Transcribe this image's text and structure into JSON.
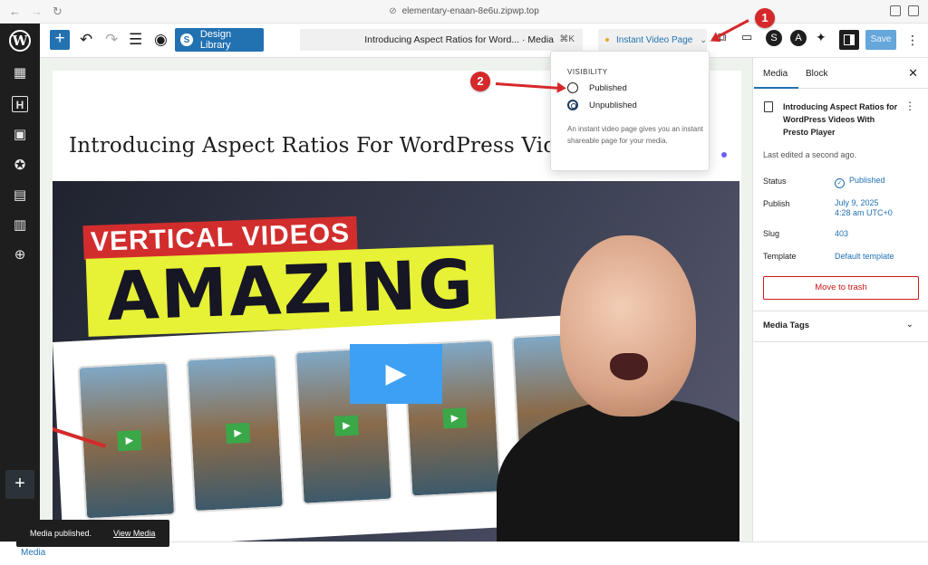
{
  "browser": {
    "url": "elementary-enaan-8e6u.zipwp.top"
  },
  "toolbar": {
    "design_library_label": "Design Library",
    "command_title": "Introducing Aspect Ratios for Word...  · Media",
    "command_shortcut": "⌘K",
    "instant_video_page_label": "Instant Video Page",
    "save_label": "Save"
  },
  "post": {
    "title": "Introducing Aspect Ratios For WordPress Videos With P"
  },
  "video": {
    "banner_text": "VERTICAL VIDEOS",
    "headline": "AMAZING !"
  },
  "popover": {
    "heading": "VISIBILITY",
    "options": [
      {
        "label": "Published",
        "checked": false
      },
      {
        "label": "Unpublished",
        "checked": true
      }
    ],
    "help": "An instant video page gives you an instant shareable page for your media."
  },
  "annotations": {
    "badge1": "1",
    "badge2": "2"
  },
  "panel": {
    "tabs": [
      "Media",
      "Block"
    ],
    "title": "Introducing Aspect Ratios for WordPress Videos With Presto Player",
    "last_edited": "Last edited a second ago.",
    "rows": {
      "status_label": "Status",
      "status_value": "Published",
      "publish_label": "Publish",
      "publish_value_1": "July 9, 2025",
      "publish_value_2": "4:28 am UTC+0",
      "slug_label": "Slug",
      "slug_value": "403",
      "template_label": "Template",
      "template_value": "Default template"
    },
    "trash_label": "Move to trash",
    "tags_label": "Media Tags"
  },
  "footer": {
    "breadcrumb": "Media"
  },
  "snackbar": {
    "message": "Media published.",
    "action": "View Media"
  },
  "colors": {
    "accent": "#2271b1",
    "danger": "#cc1818",
    "annotation_red": "#d5282b",
    "admin_dark": "#1e1e1e"
  }
}
